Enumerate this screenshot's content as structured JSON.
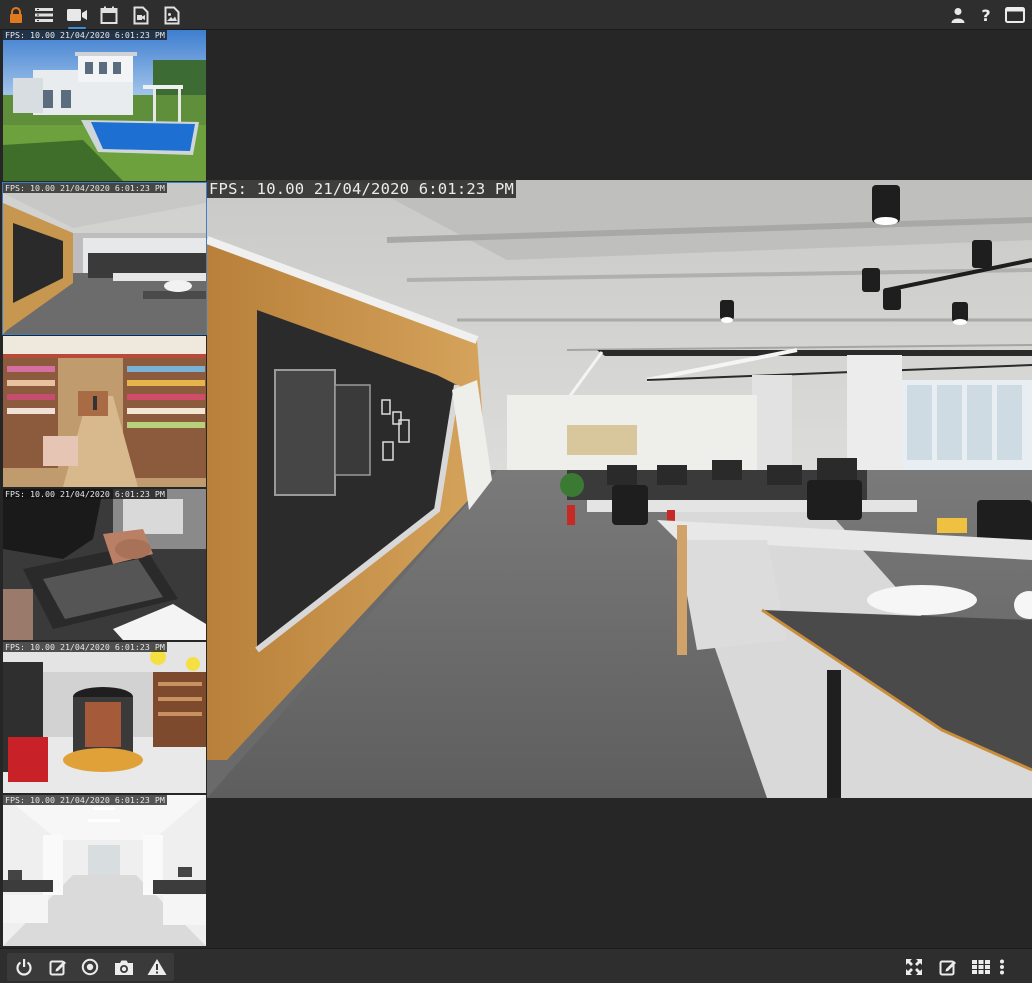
{
  "toolbar": {
    "left_icons": [
      "lock-icon",
      "list-icon",
      "video-camera-icon",
      "calendar-icon",
      "video-file-icon",
      "image-file-icon"
    ],
    "right_icons": [
      "user-icon",
      "help-icon",
      "window-icon"
    ],
    "help_label": "?"
  },
  "tiles": [
    {
      "osd": "FPS: 10.00 21/04/2020 6:01:23 PM",
      "scene": "villa-pool"
    },
    {
      "osd": "FPS: 10.00 21/04/2020 6:01:23 PM",
      "scene": "office-corridor"
    },
    {
      "osd": "",
      "scene": "store-aisles"
    },
    {
      "osd": "FPS: 10.00 21/04/2020 6:01:23 PM",
      "scene": "cash-register"
    },
    {
      "osd": "FPS: 10.00 21/04/2020 6:01:23 PM",
      "scene": "showroom"
    },
    {
      "osd": "FPS: 10.00 21/04/2020 6:01:23 PM",
      "scene": "white-office"
    }
  ],
  "main_view": {
    "osd": "FPS: 10.00 21/04/2020 6:01:23 PM",
    "scene": "office-corridor"
  },
  "bottom": {
    "left_icons": [
      "power-icon",
      "edit-icon",
      "record-icon",
      "camera-icon",
      "warning-icon"
    ],
    "right_icons": [
      "fullscreen-icon",
      "edit-icon",
      "grid-icon",
      "more-vertical-icon"
    ]
  },
  "colors": {
    "background": "#262626",
    "toolbar": "#2e2e2e",
    "accent": "#3a8fd9",
    "lock": "#e07a1e",
    "icon": "#e8e8e8"
  }
}
